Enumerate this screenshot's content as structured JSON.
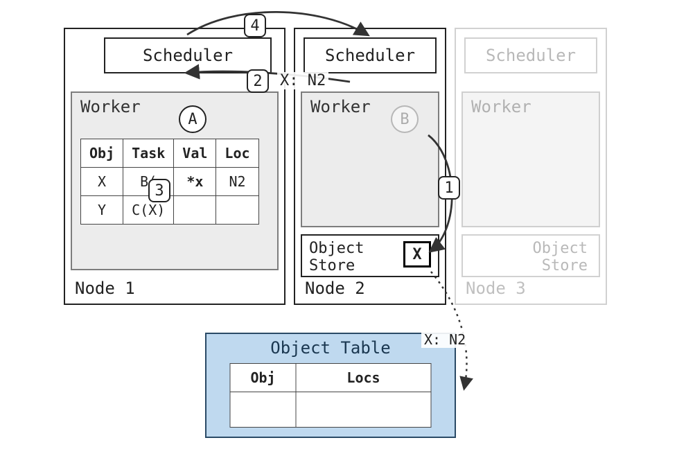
{
  "nodes": {
    "n1": {
      "label": "Node 1",
      "scheduler": "Scheduler",
      "worker": "Worker",
      "badge": "A"
    },
    "n2": {
      "label": "Node 2",
      "scheduler": "Scheduler",
      "worker": "Worker",
      "badge": "B",
      "object_store_label": "Object\nStore",
      "object_store_item": "X"
    },
    "n3": {
      "label": "Node 3",
      "scheduler": "Scheduler",
      "worker": "Worker",
      "object_store_label": "Object\nStore"
    }
  },
  "steps": {
    "s1": "1",
    "s2": "2",
    "s3": "3",
    "s4": "4"
  },
  "annotations": {
    "arrow2": "X: N2",
    "arrow_store": "X: N2"
  },
  "worker_table": {
    "headers": [
      "Obj",
      "Task",
      "Val",
      "Loc"
    ],
    "rows": [
      {
        "obj": "X",
        "task": "B(",
        "val": "*x",
        "loc": "N2"
      },
      {
        "obj": "Y",
        "task": "C(X)",
        "val": "",
        "loc": ""
      }
    ]
  },
  "object_table": {
    "title": "Object Table",
    "headers": [
      "Obj",
      "Locs"
    ],
    "rows": [
      {
        "obj": "",
        "locs": ""
      }
    ]
  }
}
